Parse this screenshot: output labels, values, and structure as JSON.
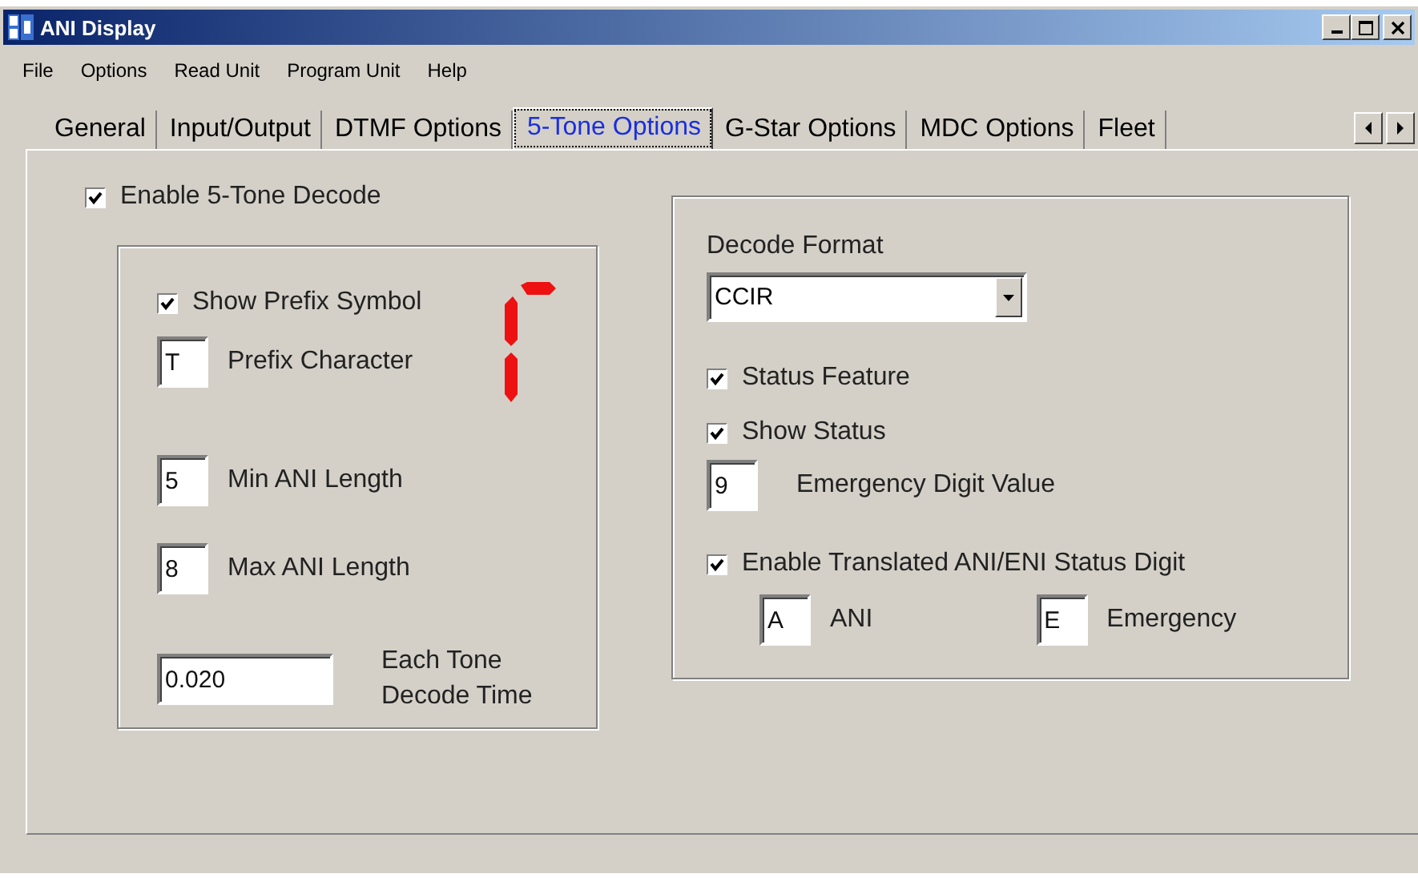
{
  "window": {
    "title": "ANI Display"
  },
  "menu": [
    "File",
    "Options",
    "Read Unit",
    "Program Unit",
    "Help"
  ],
  "tabs": [
    {
      "label": "General",
      "selected": false
    },
    {
      "label": "Input/Output",
      "selected": false
    },
    {
      "label": "DTMF Options",
      "selected": false
    },
    {
      "label": "5-Tone Options",
      "selected": true
    },
    {
      "label": "G-Star Options",
      "selected": false
    },
    {
      "label": "MDC Options",
      "selected": false
    },
    {
      "label": "Fleet",
      "selected": false
    }
  ],
  "enable_decode": {
    "label": "Enable 5-Tone Decode",
    "checked": true
  },
  "prefix_group": {
    "show_prefix": {
      "label": "Show Prefix Symbol",
      "checked": true
    },
    "prefix_character": {
      "value": "T",
      "label": "Prefix Character"
    },
    "min_ani_length": {
      "value": "5",
      "label": "Min ANI Length"
    },
    "max_ani_length": {
      "value": "8",
      "label": "Max ANI Length"
    },
    "tone_decode_time": {
      "value": "0.020",
      "label": "Each Tone Decode Time"
    }
  },
  "format_group": {
    "decode_format": {
      "label": "Decode Format",
      "value": "CCIR"
    },
    "status_feature": {
      "label": "Status Feature",
      "checked": true
    },
    "show_status": {
      "label": "Show Status",
      "checked": true
    },
    "emergency_digit": {
      "value": "9",
      "label": "Emergency Digit Value"
    },
    "translated": {
      "label": "Enable Translated ANI/ENI Status Digit",
      "checked": true
    },
    "ani": {
      "value": "A",
      "label": "ANI"
    },
    "emergency": {
      "value": "E",
      "label": "Emergency"
    }
  }
}
